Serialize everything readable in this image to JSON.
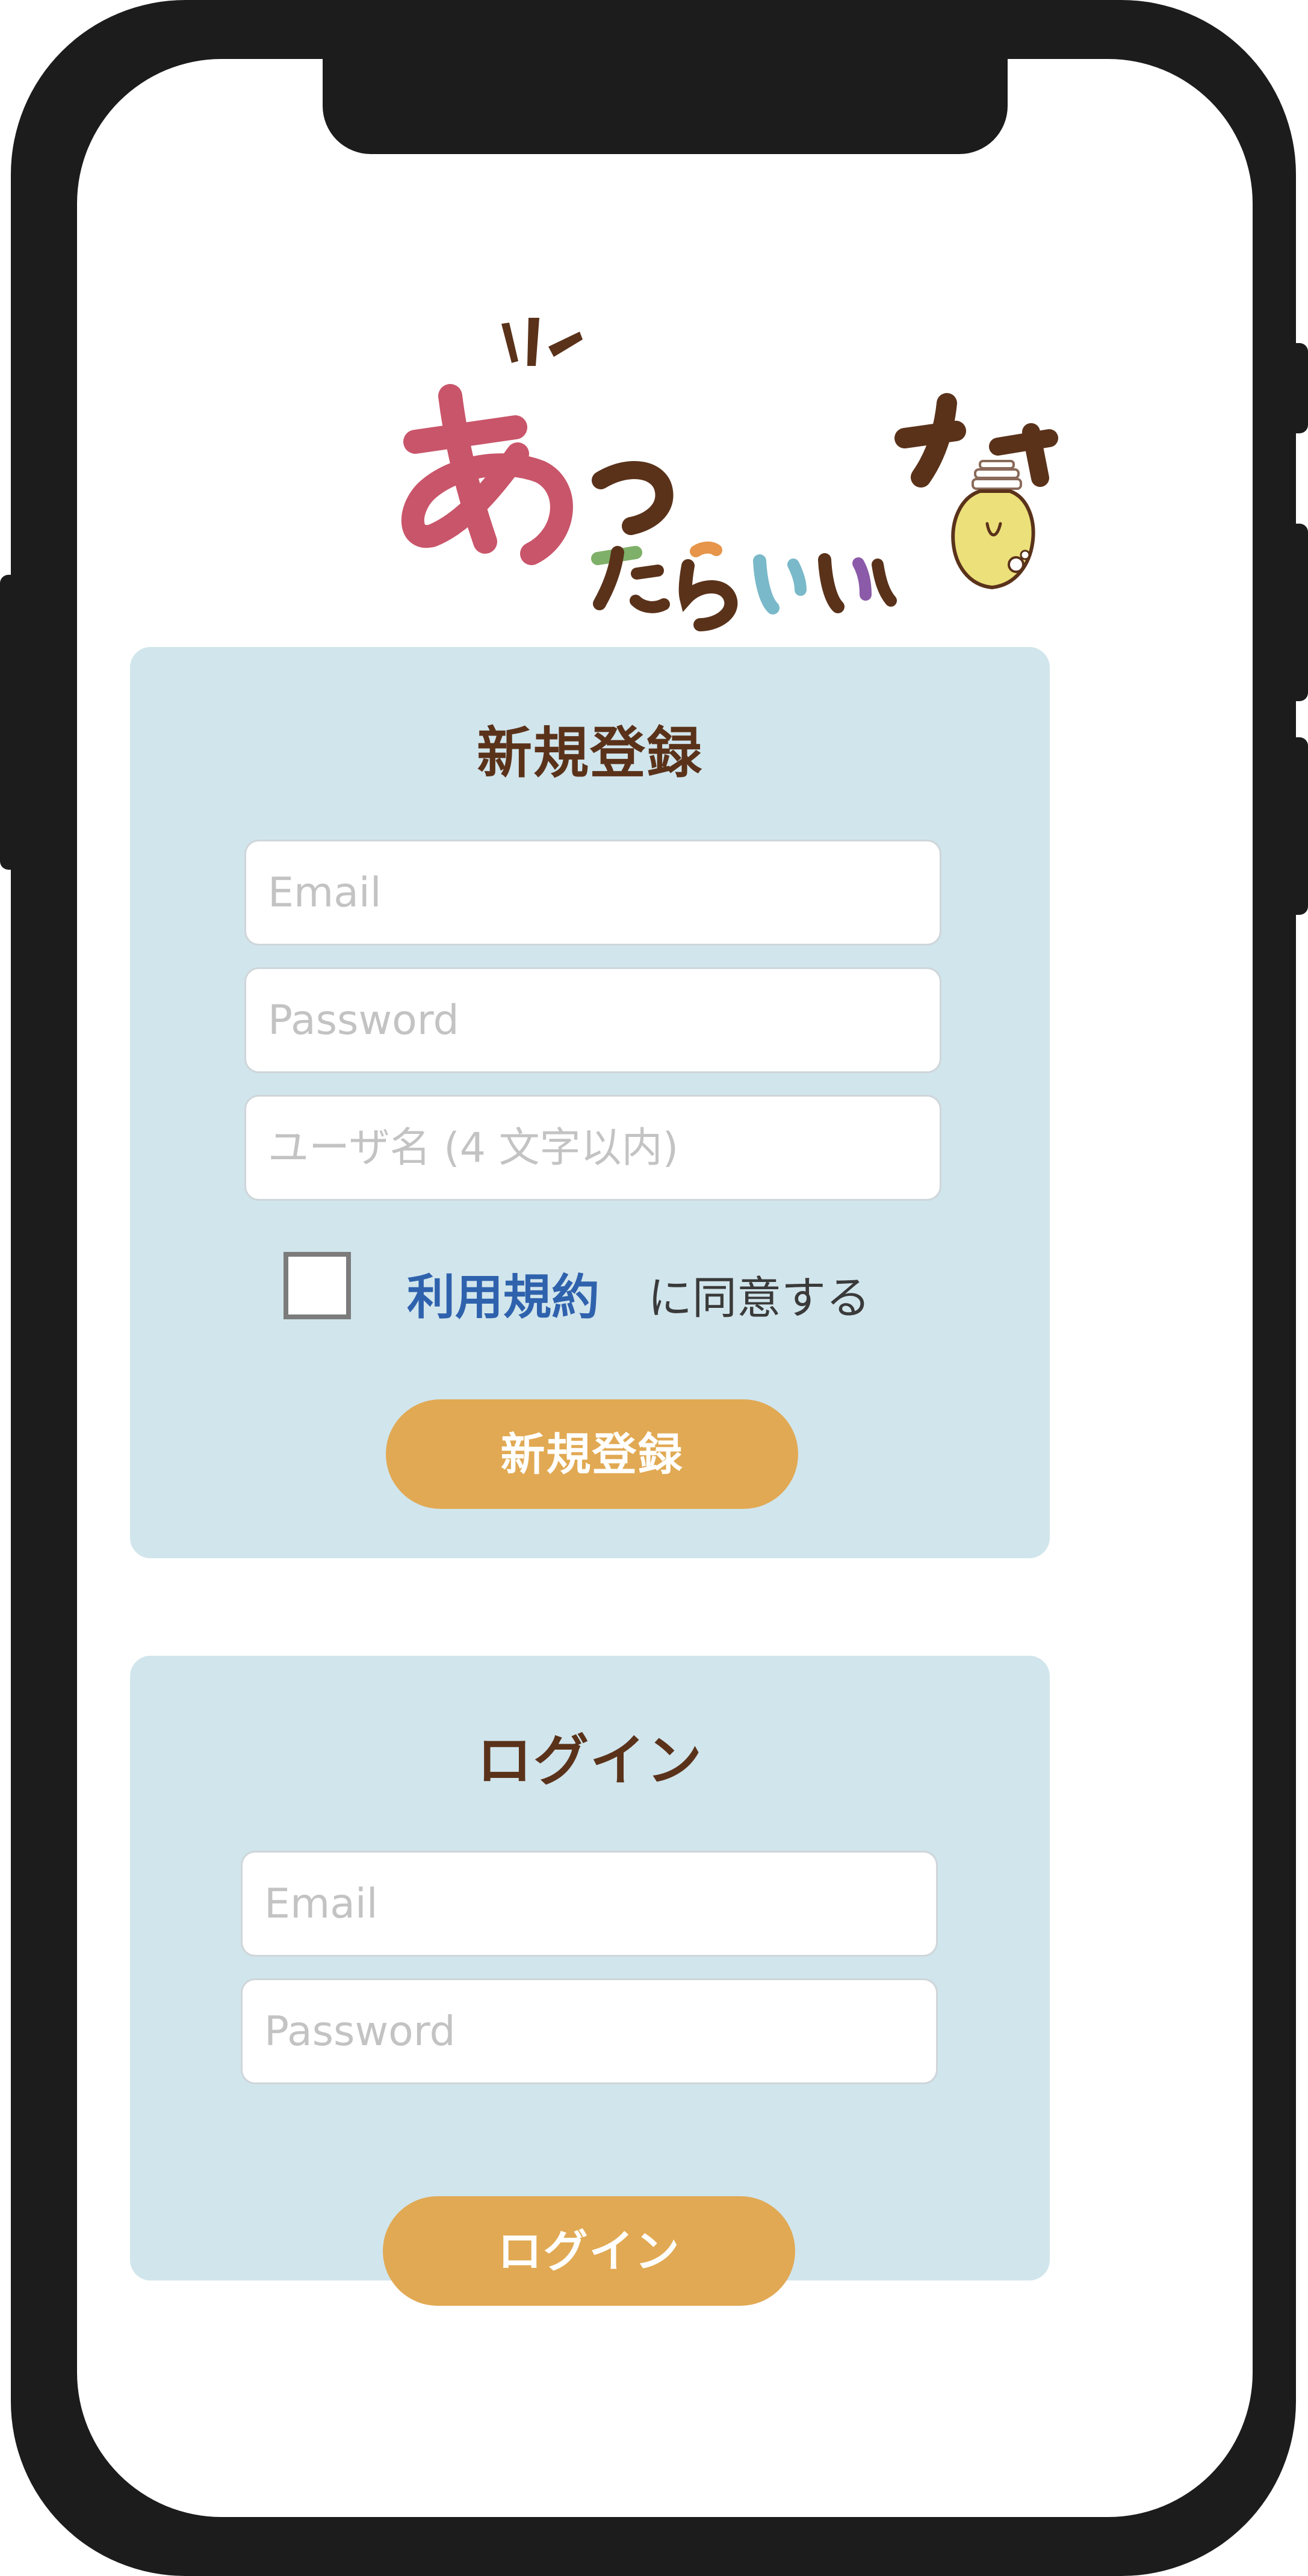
{
  "logo": {
    "text": "あったらいいな"
  },
  "signup": {
    "title": "新規登録",
    "email_placeholder": "Email",
    "password_placeholder": "Password",
    "username_placeholder": "ユーザ名 (4 文字以内)",
    "terms_link": "利用規約",
    "terms_text": "に同意する",
    "terms_checked": false,
    "button_label": "新規登録"
  },
  "login": {
    "title": "ログイン",
    "email_placeholder": "Email",
    "password_placeholder": "Password",
    "button_label": "ログイン"
  },
  "colors": {
    "card_bg": "#d1e5ec",
    "title": "#5a321a",
    "button": "#e1a953",
    "link": "#2f62ad",
    "frame": "#1c1c1c"
  }
}
